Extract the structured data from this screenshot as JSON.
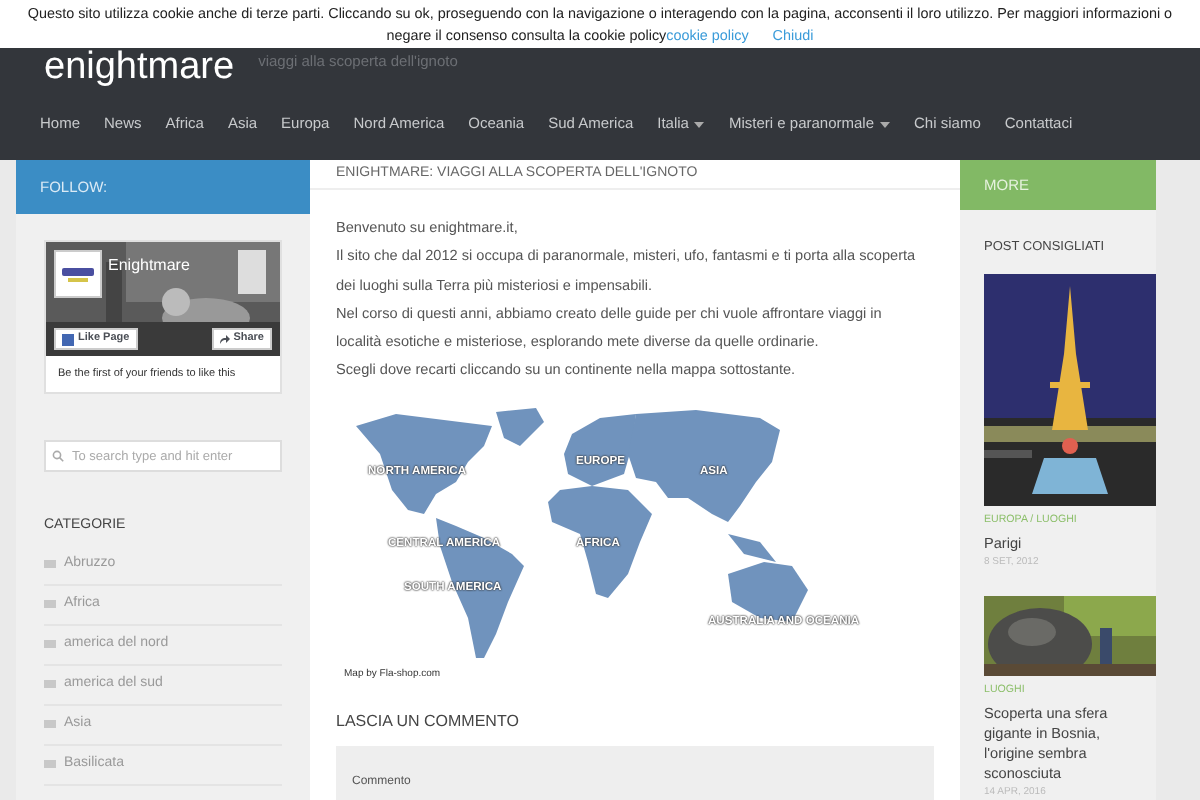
{
  "cookie_bar": {
    "text": "Questo sito utilizza cookie anche di terze parti. Cliccando su ok, proseguendo con la navigazione o interagendo con la pagina, acconsenti il loro utilizzo. Per maggiori informazioni o negare il consenso consulta la cookie policy",
    "link": "cookie policy",
    "close": "Chiudi"
  },
  "header": {
    "logo": "enightmare",
    "tagline": "viaggi alla scoperta dell'ignoto"
  },
  "nav": [
    {
      "label": "Home",
      "dropdown": false
    },
    {
      "label": "News",
      "dropdown": false
    },
    {
      "label": "Africa",
      "dropdown": false
    },
    {
      "label": "Asia",
      "dropdown": false
    },
    {
      "label": "Europa",
      "dropdown": false
    },
    {
      "label": "Nord America",
      "dropdown": false
    },
    {
      "label": "Oceania",
      "dropdown": false
    },
    {
      "label": "Sud America",
      "dropdown": false
    },
    {
      "label": "Italia",
      "dropdown": true
    },
    {
      "label": "Misteri e paranormale",
      "dropdown": true
    },
    {
      "label": "Chi siamo",
      "dropdown": false
    },
    {
      "label": "Contattaci",
      "dropdown": false
    }
  ],
  "left_sidebar": {
    "heading": "FOLLOW:",
    "facebook": {
      "page_name": "Enightmare",
      "like_button": "Like Page",
      "share_button": "Share",
      "friends_text": "Be the first of your friends to like this"
    },
    "search": {
      "placeholder": "To search type and hit enter"
    },
    "categories": {
      "title": "CATEGORIE",
      "items": [
        "Abruzzo",
        "Africa",
        "america del nord",
        "america del sud",
        "Asia",
        "Basilicata"
      ]
    }
  },
  "main": {
    "title": "ENIGHTMARE: VIAGGI ALLA SCOPERTA DELL'IGNOTO",
    "intro": [
      "Benvenuto su enightmare.it,",
      "Il sito che dal 2012 si occupa di paranormale, misteri, ufo, fantasmi e ti porta alla scoperta dei luoghi sulla Terra più misteriosi e impensabili.",
      "Nel corso di questi anni, abbiamo creato delle guide per chi vuole affrontare viaggi in località esotiche e misteriose, esplorando mete diverse da quelle ordinarie.",
      "Scegli dove recarti cliccando su un continente nella mappa sottostante."
    ],
    "map": {
      "labels": [
        "NORTH AMERICA",
        "CENTRAL AMERICA",
        "SOUTH AMERICA",
        "EUROPE",
        "AFRICA",
        "ASIA",
        "AUSTRALIA AND OCEANIA"
      ],
      "credit": "Map by Fla-shop.com"
    },
    "comment": {
      "heading": "LASCIA UN COMMENTO",
      "field_label": "Commento"
    }
  },
  "right_sidebar": {
    "heading": "MORE",
    "title": "POST CONSIGLIATI",
    "posts": [
      {
        "category": "EUROPA / LUOGHI",
        "title": "Parigi",
        "date": "8 SET, 2012"
      },
      {
        "category": "LUOGHI",
        "title": "Scoperta una sfera gigante in Bosnia, l'origine sembra sconosciuta",
        "date": "14 APR, 2016"
      }
    ]
  }
}
